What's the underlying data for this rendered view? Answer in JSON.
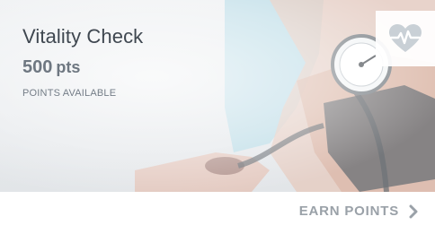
{
  "card": {
    "title": "Vitality Check",
    "points_value": "500",
    "points_unit": "pts",
    "points_caption": "POINTS AVAILABLE",
    "cta_label": "EARN POINTS",
    "badge_icon": "heart-pulse-icon",
    "cta_icon": "chevron-right-icon",
    "colors": {
      "title": "#3f4750",
      "points": "#6e7781",
      "cta": "#9aa1a8",
      "heart": "#c9d0d6"
    }
  }
}
